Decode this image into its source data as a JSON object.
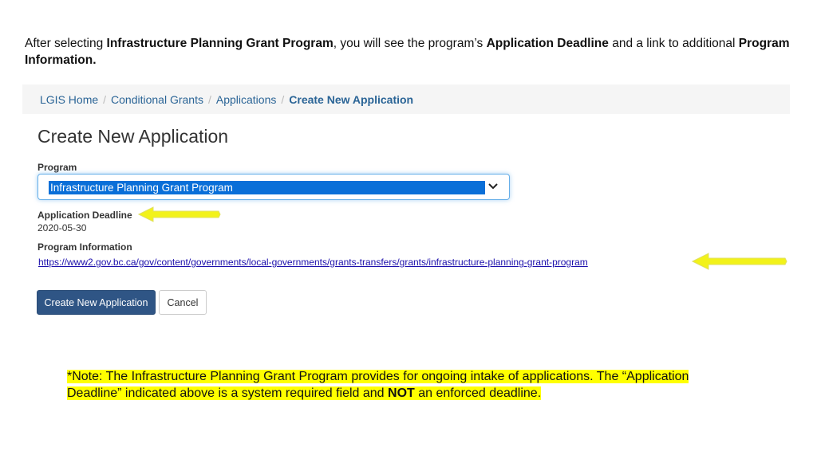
{
  "intro": {
    "part1": "After selecting ",
    "bold1": "Infrastructure Planning Grant Program",
    "part2": ", you will see the program’s ",
    "bold2": "Application Deadline",
    "part3": " and a link to additional ",
    "bold3": "Program Information."
  },
  "breadcrumb": {
    "items": [
      "LGIS Home",
      "Conditional Grants",
      "Applications"
    ],
    "separator": "/",
    "active": "Create New Application"
  },
  "page_title": "Create New Application",
  "program": {
    "label": "Program",
    "selected": "Infrastructure Planning Grant Program"
  },
  "deadline": {
    "label": "Application Deadline",
    "value": "2020-05-30"
  },
  "program_info": {
    "label": "Program Information",
    "url": "https://www2.gov.bc.ca/gov/content/governments/local-governments/grants-transfers/grants/infrastructure-planning-grant-program"
  },
  "buttons": {
    "create": "Create New Application",
    "cancel": "Cancel"
  },
  "note": {
    "part1": "*Note: The Infrastructure Planning Grant Program provides for ongoing intake of applications. The “Application Deadline” indicated above is a system required field and ",
    "bold": "NOT",
    "part2": " an enforced deadline."
  },
  "colors": {
    "arrow": "#f2f21a",
    "highlight": "#ffff00",
    "link": "#2a6496",
    "primary_button": "#2f5585"
  },
  "icons": [
    "chevron-down-icon",
    "arrow-left-icon"
  ]
}
